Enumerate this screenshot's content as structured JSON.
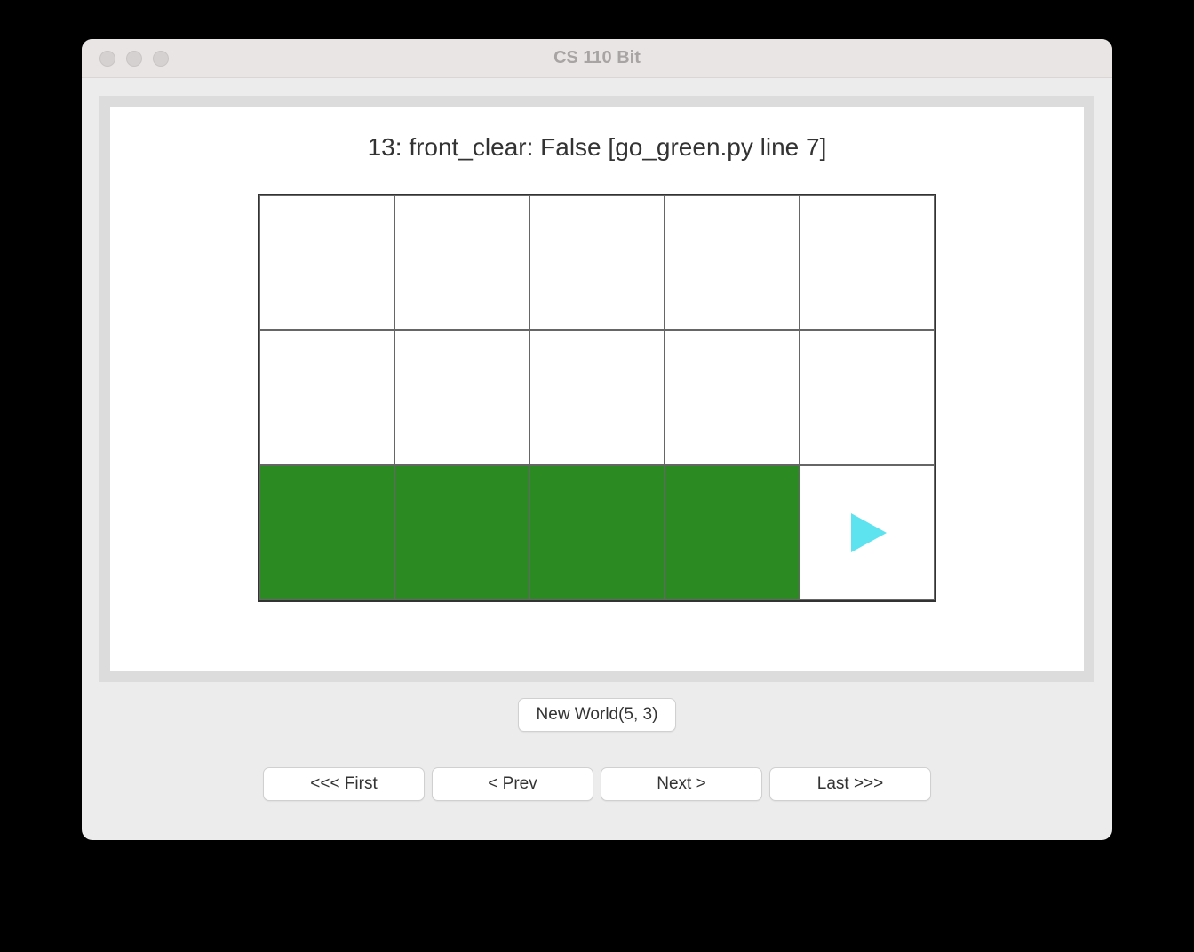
{
  "window": {
    "title": "CS 110 Bit"
  },
  "status": {
    "text": "13: front_clear: False  [go_green.py line 7]"
  },
  "grid": {
    "cols": 5,
    "rows": 3,
    "green_cells": [
      [
        2,
        0
      ],
      [
        2,
        1
      ],
      [
        2,
        2
      ],
      [
        2,
        3
      ]
    ],
    "bit_position": [
      2,
      4
    ],
    "bit_direction": "right"
  },
  "buttons": {
    "new_world": "New World(5, 3)",
    "first": "<<< First",
    "prev": "< Prev",
    "next": "Next >",
    "last": "Last >>>"
  }
}
